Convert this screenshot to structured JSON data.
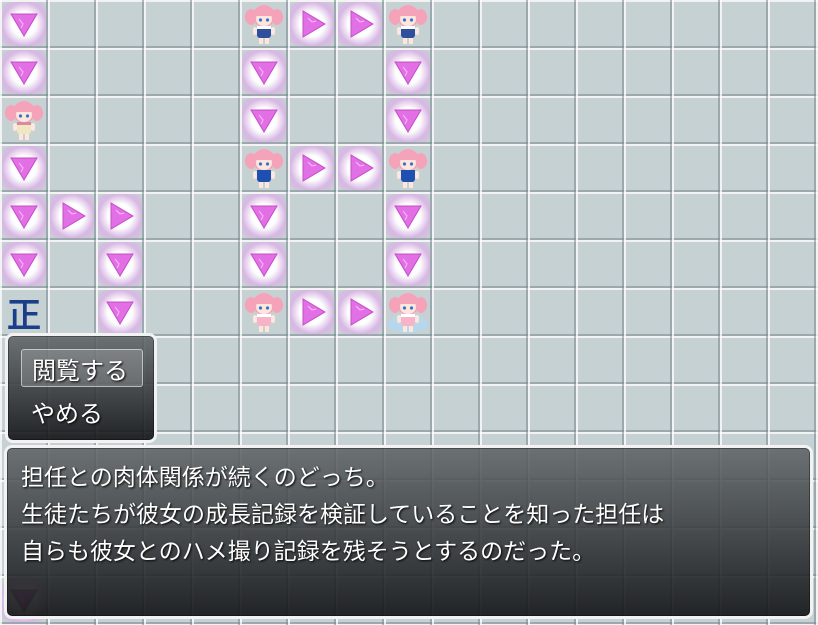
{
  "board": {
    "tile_kanji": "正",
    "arrows": [
      {
        "col": 0,
        "row": 0,
        "dir": "down"
      },
      {
        "col": 6,
        "row": 0,
        "dir": "right"
      },
      {
        "col": 7,
        "row": 0,
        "dir": "right"
      },
      {
        "col": 0,
        "row": 1,
        "dir": "down"
      },
      {
        "col": 5,
        "row": 1,
        "dir": "down"
      },
      {
        "col": 8,
        "row": 1,
        "dir": "down"
      },
      {
        "col": 5,
        "row": 2,
        "dir": "down"
      },
      {
        "col": 8,
        "row": 2,
        "dir": "down"
      },
      {
        "col": 0,
        "row": 3,
        "dir": "down"
      },
      {
        "col": 6,
        "row": 3,
        "dir": "right"
      },
      {
        "col": 7,
        "row": 3,
        "dir": "right"
      },
      {
        "col": 0,
        "row": 4,
        "dir": "down"
      },
      {
        "col": 1,
        "row": 4,
        "dir": "right"
      },
      {
        "col": 2,
        "row": 4,
        "dir": "right"
      },
      {
        "col": 5,
        "row": 4,
        "dir": "down"
      },
      {
        "col": 8,
        "row": 4,
        "dir": "down"
      },
      {
        "col": 0,
        "row": 5,
        "dir": "down"
      },
      {
        "col": 2,
        "row": 5,
        "dir": "down"
      },
      {
        "col": 5,
        "row": 5,
        "dir": "down"
      },
      {
        "col": 8,
        "row": 5,
        "dir": "down"
      },
      {
        "col": 2,
        "row": 6,
        "dir": "down"
      },
      {
        "col": 6,
        "row": 6,
        "dir": "right"
      },
      {
        "col": 7,
        "row": 6,
        "dir": "right"
      },
      {
        "col": 0,
        "row": 12,
        "dir": "down"
      }
    ],
    "characters": [
      {
        "col": 5,
        "row": 0,
        "outfit": "sailor"
      },
      {
        "col": 8,
        "row": 0,
        "outfit": "sailor"
      },
      {
        "col": 0,
        "row": 2,
        "outfit": "casual"
      },
      {
        "col": 5,
        "row": 3,
        "outfit": "swimsuit"
      },
      {
        "col": 8,
        "row": 3,
        "outfit": "swimsuit"
      },
      {
        "col": 5,
        "row": 6,
        "outfit": "pink"
      },
      {
        "col": 8,
        "row": 6,
        "outfit": "pink-glow"
      }
    ]
  },
  "choices": [
    "閲覧する",
    "やめる"
  ],
  "message": [
    "担任との肉体関係が続くのどっち。",
    "生徒たちが彼女の成長記録を検証していることを知った担任は",
    "自らも彼女とのハメ撮り記録を残そうとするのだった。"
  ],
  "colors": {
    "arrow": "#e36fe6",
    "hair": "#f4a3b8",
    "kanji": "#1a3f8a"
  }
}
